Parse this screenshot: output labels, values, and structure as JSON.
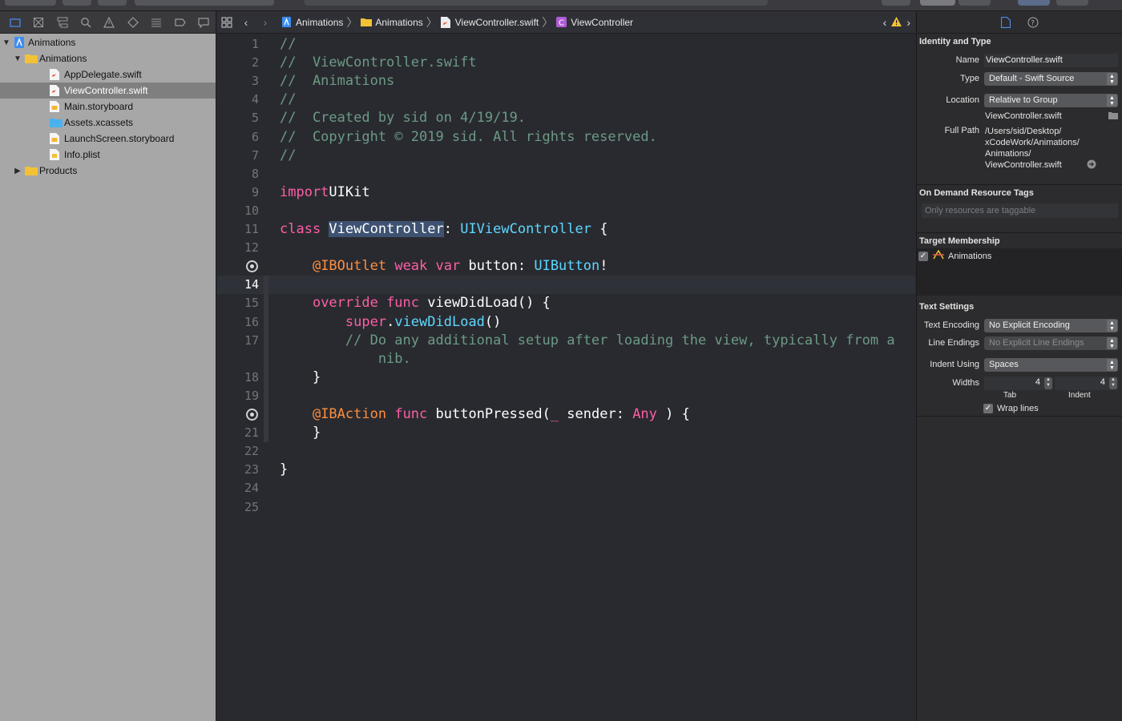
{
  "navigator": {
    "toolbar_icons": [
      "folder-icon",
      "source-control-icon",
      "hierarchy-icon",
      "search-icon",
      "warning-icon",
      "test-icon",
      "debug-icon",
      "breakpoint-icon",
      "report-icon"
    ],
    "items": [
      {
        "label": "Animations",
        "kind": "project",
        "indent": 0,
        "disclosure": "▼"
      },
      {
        "label": "Animations",
        "kind": "group",
        "indent": 1,
        "disclosure": "▼"
      },
      {
        "label": "AppDelegate.swift",
        "kind": "swift",
        "indent": 2
      },
      {
        "label": "ViewController.swift",
        "kind": "swift",
        "indent": 2,
        "selected": true
      },
      {
        "label": "Main.storyboard",
        "kind": "storyboard",
        "indent": 2
      },
      {
        "label": "Assets.xcassets",
        "kind": "assets",
        "indent": 2
      },
      {
        "label": "LaunchScreen.storyboard",
        "kind": "storyboard",
        "indent": 2
      },
      {
        "label": "Info.plist",
        "kind": "plist",
        "indent": 2
      },
      {
        "label": "Products",
        "kind": "group",
        "indent": 1,
        "disclosure": "▶"
      }
    ]
  },
  "jumpbar": {
    "crumbs": [
      "Animations",
      "Animations",
      "ViewController.swift",
      "ViewController"
    ]
  },
  "editor": {
    "current_line": 14,
    "lines": [
      {
        "n": "1",
        "segs": [
          [
            "c-com",
            "//"
          ]
        ]
      },
      {
        "n": "2",
        "segs": [
          [
            "c-com",
            "//  ViewController.swift"
          ]
        ]
      },
      {
        "n": "3",
        "segs": [
          [
            "c-com",
            "//  Animations"
          ]
        ]
      },
      {
        "n": "4",
        "segs": [
          [
            "c-com",
            "//"
          ]
        ]
      },
      {
        "n": "5",
        "segs": [
          [
            "c-com",
            "//  Created by sid on 4/19/19."
          ]
        ]
      },
      {
        "n": "6",
        "segs": [
          [
            "c-com",
            "//  Copyright © 2019 sid. All rights reserved."
          ]
        ]
      },
      {
        "n": "7",
        "segs": [
          [
            "c-com",
            "//"
          ]
        ]
      },
      {
        "n": "8",
        "segs": []
      },
      {
        "n": "9",
        "segs": [
          [
            "c-kw",
            "import"
          ],
          [
            "",
            "UIKit"
          ]
        ]
      },
      {
        "n": "10",
        "segs": []
      },
      {
        "n": "11",
        "segs": [
          [
            "c-kw",
            "class "
          ],
          [
            "c-hl",
            "ViewController"
          ],
          [
            "",
            ": "
          ],
          [
            "c-type",
            "UIViewController"
          ],
          [
            "",
            " {"
          ]
        ]
      },
      {
        "n": "12",
        "segs": []
      },
      {
        "n": "13",
        "bp": true,
        "segs": [
          [
            "",
            "    "
          ],
          [
            "c-at",
            "@IBOutlet"
          ],
          [
            "",
            " "
          ],
          [
            "c-kw",
            "weak var"
          ],
          [
            "",
            " button: "
          ],
          [
            "c-type",
            "UIButton"
          ],
          [
            "",
            "!"
          ]
        ]
      },
      {
        "n": "14",
        "segs": []
      },
      {
        "n": "15",
        "segs": [
          [
            "",
            "    "
          ],
          [
            "c-kw",
            "override func"
          ],
          [
            "",
            " viewDidLoad() {"
          ]
        ]
      },
      {
        "n": "16",
        "segs": [
          [
            "",
            "        "
          ],
          [
            "c-kw",
            "super"
          ],
          [
            "",
            "."
          ],
          [
            "c-type",
            "viewDidLoad"
          ],
          [
            "",
            "()"
          ]
        ]
      },
      {
        "n": "17",
        "segs": [
          [
            "c-com",
            "        // Do any additional setup after loading the view, typically from a"
          ]
        ]
      },
      {
        "n": "",
        "segs": [
          [
            "c-com",
            "            nib."
          ]
        ]
      },
      {
        "n": "18",
        "segs": [
          [
            "",
            "    }"
          ]
        ]
      },
      {
        "n": "19",
        "segs": []
      },
      {
        "n": "20",
        "bp": true,
        "segs": [
          [
            "",
            "    "
          ],
          [
            "c-at",
            "@IBAction"
          ],
          [
            "",
            " "
          ],
          [
            "c-kw",
            "func"
          ],
          [
            "",
            " buttonPressed("
          ],
          [
            "c-kw",
            "_"
          ],
          [
            "",
            " sender: "
          ],
          [
            "c-kw",
            "Any"
          ],
          [
            "",
            " ) {"
          ]
        ]
      },
      {
        "n": "21",
        "segs": [
          [
            "",
            "    }"
          ]
        ]
      },
      {
        "n": "22",
        "segs": []
      },
      {
        "n": "23",
        "segs": [
          [
            "",
            "}"
          ]
        ]
      },
      {
        "n": "24",
        "segs": []
      },
      {
        "n": "25",
        "segs": []
      }
    ]
  },
  "inspector": {
    "identity": {
      "title": "Identity and Type",
      "name_label": "Name",
      "name_value": "ViewController.swift",
      "type_label": "Type",
      "type_value": "Default - Swift Source",
      "location_label": "Location",
      "location_value": "Relative to Group",
      "location_file": "ViewController.swift",
      "fullpath_label": "Full Path",
      "fullpath_lines": [
        "/Users/sid/Desktop/",
        "xCodeWork/Animations/",
        "Animations/",
        "ViewController.swift"
      ]
    },
    "tags": {
      "title": "On Demand Resource Tags",
      "placeholder": "Only resources are taggable"
    },
    "membership": {
      "title": "Target Membership",
      "target": "Animations",
      "checked": true
    },
    "text_settings": {
      "title": "Text Settings",
      "encoding_label": "Text Encoding",
      "encoding_value": "No Explicit Encoding",
      "endings_label": "Line Endings",
      "endings_value": "No Explicit Line Endings",
      "indent_label": "Indent Using",
      "indent_value": "Spaces",
      "widths_label": "Widths",
      "tab_value": "4",
      "indent_width_value": "4",
      "tab_caption": "Tab",
      "indent_caption": "Indent",
      "wrap_label": "Wrap lines",
      "wrap_checked": true
    }
  }
}
